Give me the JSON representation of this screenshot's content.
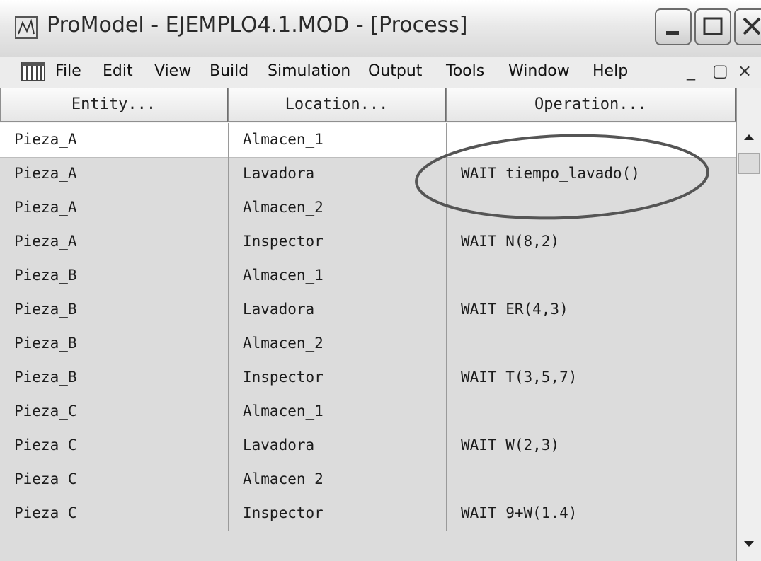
{
  "window": {
    "title": "ProModel - EJEMPLO4.1.MOD - [Process]"
  },
  "menu": [
    "File",
    "Edit",
    "View",
    "Build",
    "Simulation",
    "Output",
    "Tools",
    "Window",
    "Help"
  ],
  "mdi_controls": {
    "minimize": "_",
    "restore": "▢",
    "close": "×"
  },
  "columns": [
    "Entity...",
    "Location...",
    "Operation..."
  ],
  "rows": [
    {
      "entity": "Pieza_A",
      "location": "Almacen_1",
      "operation": ""
    },
    {
      "entity": "Pieza_A",
      "location": "Lavadora",
      "operation": "WAIT tiempo_lavado()"
    },
    {
      "entity": "Pieza_A",
      "location": "Almacen_2",
      "operation": ""
    },
    {
      "entity": "Pieza_A",
      "location": "Inspector",
      "operation": "WAIT N(8,2)"
    },
    {
      "entity": "Pieza_B",
      "location": "Almacen_1",
      "operation": ""
    },
    {
      "entity": "Pieza_B",
      "location": "Lavadora",
      "operation": "WAIT ER(4,3)"
    },
    {
      "entity": "Pieza_B",
      "location": "Almacen_2",
      "operation": ""
    },
    {
      "entity": "Pieza_B",
      "location": "Inspector",
      "operation": "WAIT T(3,5,7)"
    },
    {
      "entity": "Pieza_C",
      "location": "Almacen_1",
      "operation": ""
    },
    {
      "entity": "Pieza_C",
      "location": "Lavadora",
      "operation": "WAIT W(2,3)"
    },
    {
      "entity": "Pieza_C",
      "location": "Almacen_2",
      "operation": ""
    },
    {
      "entity": "Pieza C",
      "location": "Inspector",
      "operation": "WAIT 9+W(1.4)"
    }
  ],
  "highlight": {
    "row_index": 1,
    "column": "operation",
    "color": "#555555"
  }
}
